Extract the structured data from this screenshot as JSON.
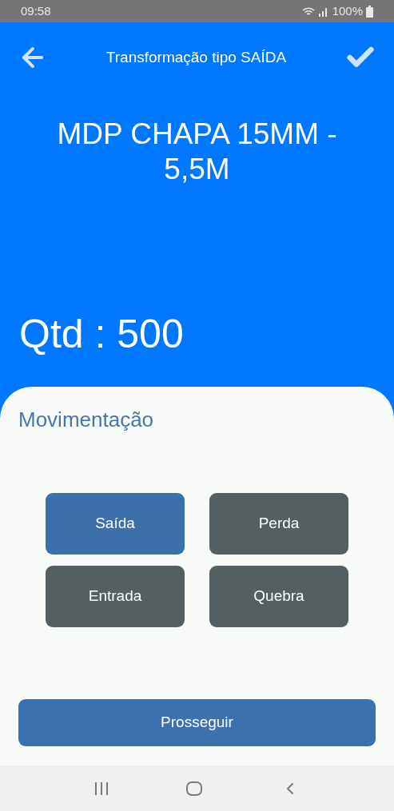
{
  "status_bar": {
    "time": "09:58",
    "battery": "100%"
  },
  "header": {
    "title": "Transformação tipo SAÍDA"
  },
  "product": {
    "name": "MDP CHAPA 15MM - 5,5M",
    "quantity": "Qtd : 500"
  },
  "movement": {
    "title": "Movimentação",
    "options": [
      {
        "label": "Saída",
        "selected": true
      },
      {
        "label": "Perda",
        "selected": false
      },
      {
        "label": "Entrada",
        "selected": false
      },
      {
        "label": "Quebra",
        "selected": false
      }
    ],
    "button": "Prosseguir"
  }
}
